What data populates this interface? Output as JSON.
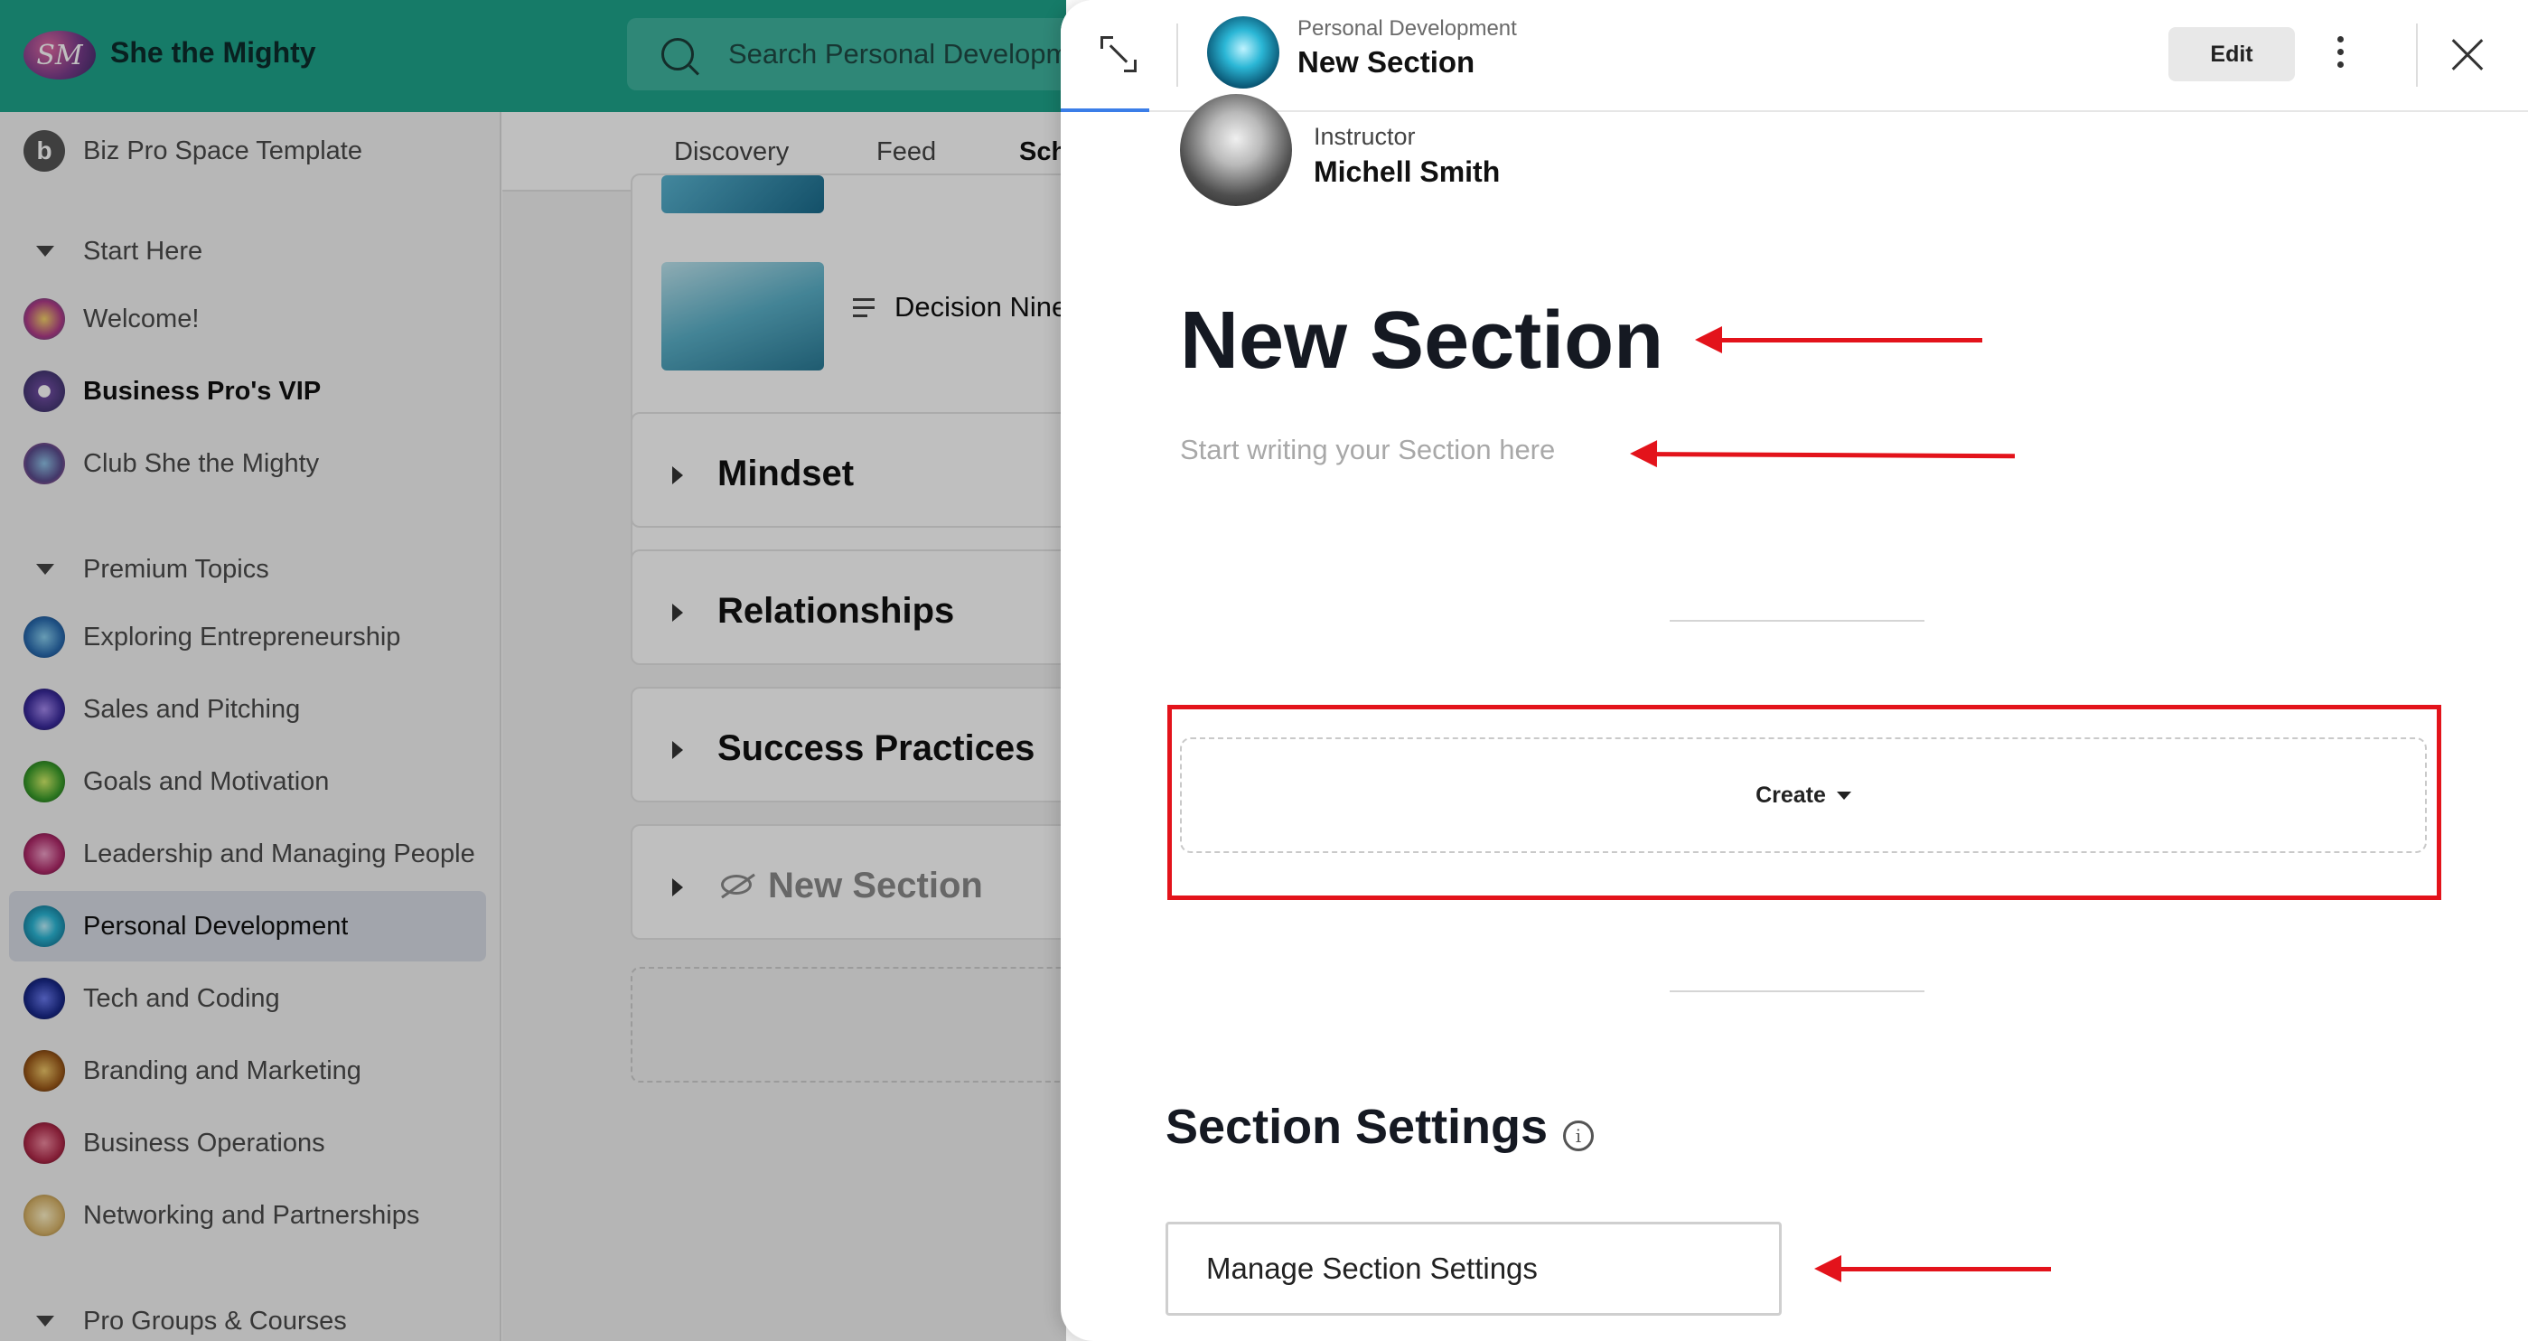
{
  "app": {
    "name": "She the Mighty",
    "logo_text": "SM",
    "search_placeholder": "Search Personal Development"
  },
  "sidebar": {
    "top_item": "Biz Pro Space Template",
    "groups": [
      {
        "label": "Start Here",
        "items": [
          "Welcome!",
          "Business Pro's VIP",
          "Club She the Mighty"
        ]
      },
      {
        "label": "Premium Topics",
        "items": [
          "Exploring Entrepreneurship",
          "Sales and Pitching",
          "Goals and Motivation",
          "Leadership and Managing People",
          "Personal Development",
          "Tech and Coding",
          "Branding and Marketing",
          "Business Operations",
          "Networking and Partnerships"
        ]
      },
      {
        "label": "Pro Groups & Courses",
        "items": []
      }
    ],
    "active_item": "Personal Development"
  },
  "middle": {
    "tabs": [
      "Discovery",
      "Feed",
      "Sch"
    ],
    "lesson_title": "Decision Nine",
    "sections": [
      "Mindset",
      "Relationships",
      "Success Practices",
      "New Section"
    ]
  },
  "panel": {
    "breadcrumb": "Personal Development",
    "title": "New Section",
    "edit_label": "Edit",
    "instructor_label": "Instructor",
    "instructor_name": "Michell Smith",
    "doc_title": "New Section",
    "doc_placeholder": "Start writing your Section here",
    "create_label": "Create",
    "settings_heading": "Section Settings",
    "manage_label": "Manage Section Settings"
  },
  "colors": {
    "brand": "#1ea48b",
    "annotation": "#e3131b",
    "active_tab_underline": "#3b7ee8"
  }
}
